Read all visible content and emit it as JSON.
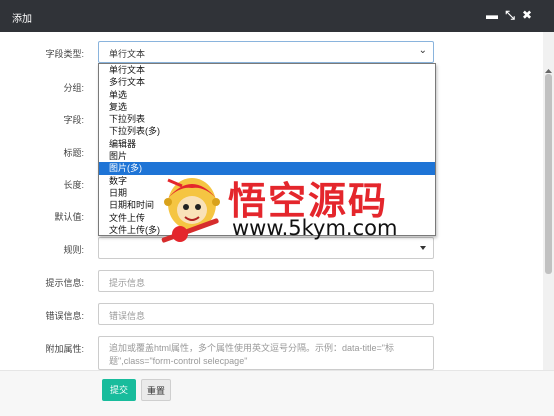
{
  "window": {
    "title": "添加",
    "controls": {
      "minimize": "▬",
      "maximize": "⤡",
      "close": "✖"
    }
  },
  "form": {
    "field_type": {
      "label": "字段类型:",
      "value": "单行文本"
    },
    "group": {
      "label": "分组:"
    },
    "field": {
      "label": "字段:"
    },
    "title": {
      "label": "标题:"
    },
    "length": {
      "label": "长度:"
    },
    "default_value": {
      "label": "默认值:"
    },
    "rule": {
      "label": "规则:"
    },
    "hint": {
      "label": "提示信息:",
      "placeholder": "提示信息"
    },
    "error": {
      "label": "错误信息:",
      "placeholder": "错误信息"
    },
    "extra_attr": {
      "label": "附加属性:",
      "placeholder": "追加或覆盖html属性，多个属性使用英文逗号分隔。示例：data-title=\"标题\",class=\"form-control selecpage\""
    }
  },
  "dropdown": {
    "options": [
      "单行文本",
      "多行文本",
      "单选",
      "复选",
      "下拉列表",
      "下拉列表(多)",
      "编辑器",
      "图片",
      "图片(多)",
      "数字",
      "日期",
      "日期和时间",
      "文件上传",
      "文件上传(多)"
    ],
    "selected_index": 8
  },
  "watermark": {
    "title": "悟空源码",
    "url": "www.5kym.com"
  },
  "footer": {
    "submit_label": "提交",
    "reset_label": "重置"
  },
  "colors": {
    "titlebar": "#303338",
    "submit": "#18bc9c",
    "selection": "#1e74d6",
    "watermark_red": "#e4262c"
  }
}
